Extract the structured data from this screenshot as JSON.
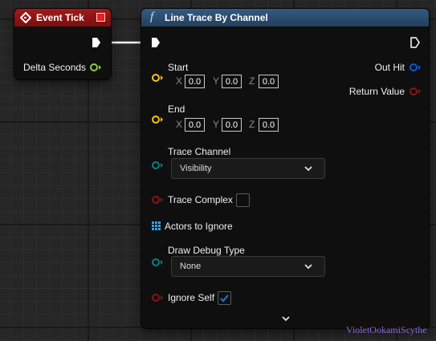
{
  "event_node": {
    "title": "Event Tick",
    "delta_seconds_label": "Delta Seconds"
  },
  "trace_node": {
    "title": "Line Trace By Channel",
    "function_glyph": "f",
    "start_label": "Start",
    "end_label": "End",
    "start": {
      "x": "0.0",
      "y": "0.0",
      "z": "0.0"
    },
    "end": {
      "x": "0.0",
      "y": "0.0",
      "z": "0.0"
    },
    "axis_x": "X",
    "axis_y": "Y",
    "axis_z": "Z",
    "trace_channel_label": "Trace Channel",
    "trace_channel_value": "Visibility",
    "trace_complex_label": "Trace Complex",
    "trace_complex_checked": false,
    "actors_to_ignore_label": "Actors to Ignore",
    "draw_debug_type_label": "Draw Debug Type",
    "draw_debug_type_value": "None",
    "ignore_self_label": "Ignore Self",
    "ignore_self_checked": true,
    "out_hit_label": "Out Hit",
    "return_value_label": "Return Value"
  },
  "colors": {
    "event_header": "#a31a1a",
    "function_header": "#355a80",
    "vector_pin": "#f7c51a",
    "float_pin": "#8bd13c",
    "bool_pin": "#8c1414",
    "enum_pin": "#0d7d7d",
    "struct_pin": "#0a5ad8",
    "array_pin": "#3aa0e8",
    "check_blue": "#1f6fd1"
  },
  "watermark": "VioletOokamiScythe"
}
